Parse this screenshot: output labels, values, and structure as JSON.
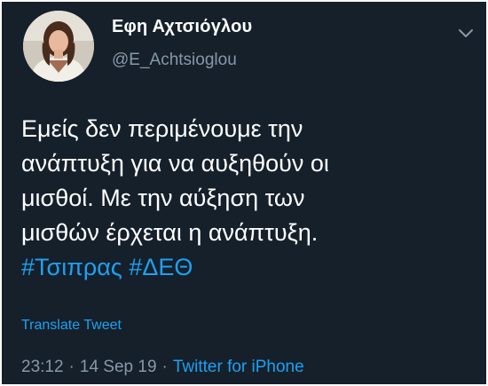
{
  "author": {
    "display_name": "Εφη Αχτσιόγλου",
    "handle": "@E_Achtsioglou"
  },
  "tweet": {
    "lines": [
      "Εμείς δεν περιμένουμε την",
      "ανάπτυξη για να αυξηθούν οι",
      "μισθοί. Με την αύξηση των",
      "μισθών έρχεται η ανάπτυξη."
    ],
    "hashtags": [
      "#Τσιπρας",
      "#ΔΕΘ"
    ]
  },
  "translate_label": "Translate Tweet",
  "meta": {
    "time": "23:12",
    "date": "14 Sep 19",
    "separator": "·",
    "source": "Twitter for iPhone"
  },
  "colors": {
    "background": "#15202b",
    "link": "#1da1f2",
    "secondary_text": "#8899a6"
  },
  "icons": {
    "menu": "chevron-down-icon"
  }
}
